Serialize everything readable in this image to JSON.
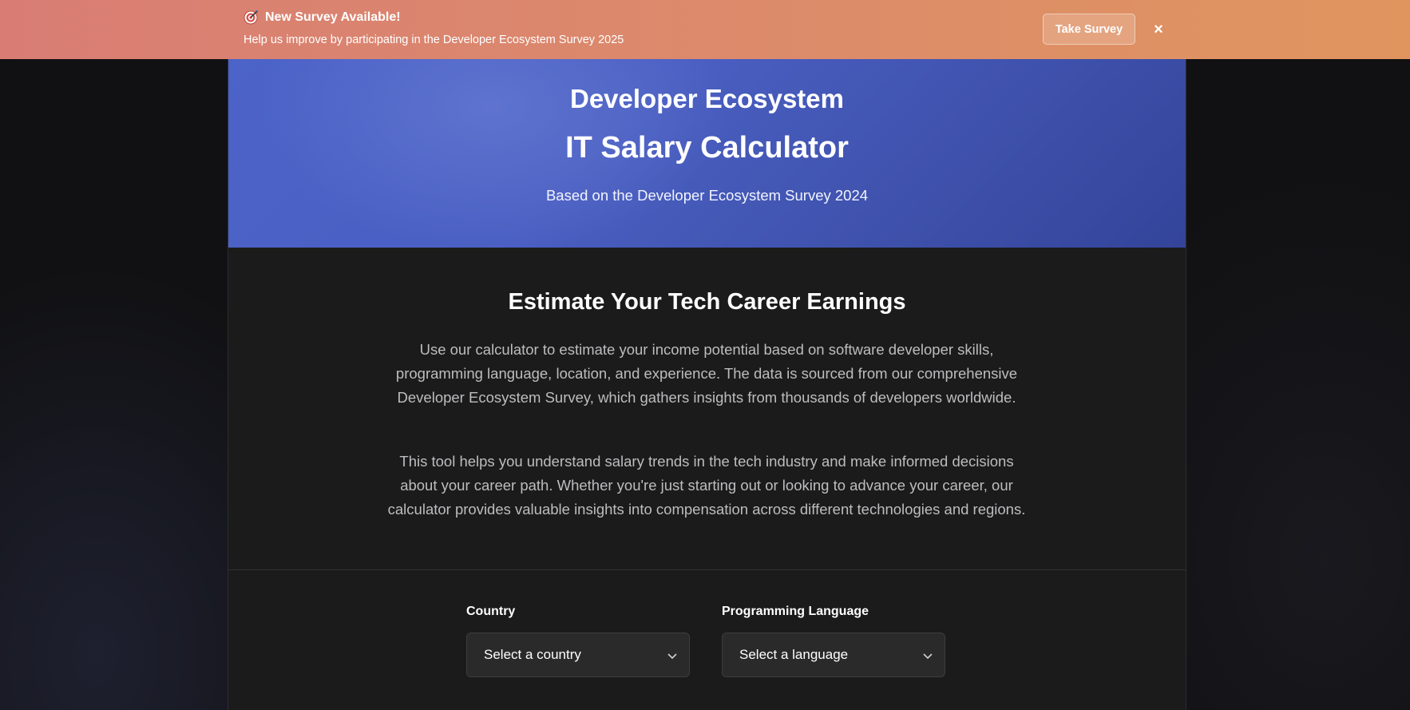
{
  "banner": {
    "icon": "dart-target-icon",
    "title": "New Survey Available!",
    "subtitle": "Help us improve by participating in the Developer Ecosystem Survey 2025",
    "cta_label": "Take Survey",
    "close_label": "×"
  },
  "hero": {
    "title_line1": "Developer Ecosystem",
    "title_line2": "IT Salary Calculator",
    "subtitle": "Based on the Developer Ecosystem Survey 2024"
  },
  "intro": {
    "heading": "Estimate Your Tech Career Earnings",
    "paragraph1": "Use our calculator to estimate your income potential based on software developer skills, programming language, location, and experience. The data is sourced from our comprehensive Developer Ecosystem Survey, which gathers insights from thousands of developers worldwide.",
    "paragraph2": "This tool helps you understand salary trends in the tech industry and make informed decisions about your career path. Whether you're just starting out or looking to advance your career, our calculator provides valuable insights into compensation across different technologies and regions."
  },
  "form": {
    "country": {
      "label": "Country",
      "value": "Select a country",
      "icon": "chevron-down-icon"
    },
    "language": {
      "label": "Programming Language",
      "value": "Select a language",
      "icon": "chevron-down-icon"
    }
  },
  "colors": {
    "banner_start": "#d97d74",
    "banner_end": "#e0955f",
    "hero_blue": "#4a5fc2",
    "panel_bg": "#1b1b1c",
    "page_bg": "#111113"
  }
}
